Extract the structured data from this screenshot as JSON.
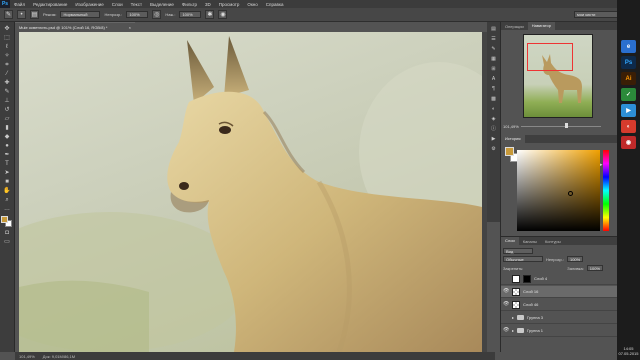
{
  "app": {
    "logo": "Ps"
  },
  "menu": [
    "Файл",
    "Редактирование",
    "Изображение",
    "Слои",
    "Текст",
    "Выделение",
    "Фильтр",
    "3D",
    "Просмотр",
    "Окно",
    "Справка"
  ],
  "options": {
    "mode_label": "Режим:",
    "mode_value": "Нормальный",
    "opacity_label": "Непрозр.:",
    "opacity_value": "100%",
    "flow_label": "Наж.:",
    "flow_value": "100%",
    "workspace": "мои кисти"
  },
  "document": {
    "tab_title": "Mule осветлить.psd @ 101% (Слой 16, RGB/8) *",
    "close": "×",
    "status_zoom": "101,49%",
    "status_doc": "Док: 9,01M/86,1M"
  },
  "navigator": {
    "tabs": [
      "Операции",
      "Навигатор"
    ],
    "zoom": "101,49%"
  },
  "color_panel": {
    "tabs": [
      "История"
    ]
  },
  "layers": {
    "tabs": [
      "Слои",
      "Каналы",
      "Контуры"
    ],
    "kind": "Вид",
    "blend": "Обычные",
    "opacity_label": "Непрозр.:",
    "opacity_value": "100%",
    "lock_label": "Закрепить:",
    "fill_label": "Заливка:",
    "fill_value": "100%",
    "items": [
      {
        "name": "Слой 4",
        "eye": ""
      },
      {
        "name": "Слой 16",
        "eye": "👁"
      },
      {
        "name": "Слой 46",
        "eye": "👁"
      },
      {
        "name": "Группа 3",
        "eye": ""
      },
      {
        "name": "Группа 1",
        "eye": "👁"
      }
    ]
  },
  "taskbar": {
    "clock_time": "14:05",
    "clock_date": "07.05.2015",
    "icons": [
      "e",
      "Ps",
      "Ai",
      "✓",
      "▶",
      "◐",
      "◉"
    ]
  },
  "colors": {
    "foreground": "#c89a3a",
    "background": "#ffffff",
    "accent": "#31a8ff"
  }
}
